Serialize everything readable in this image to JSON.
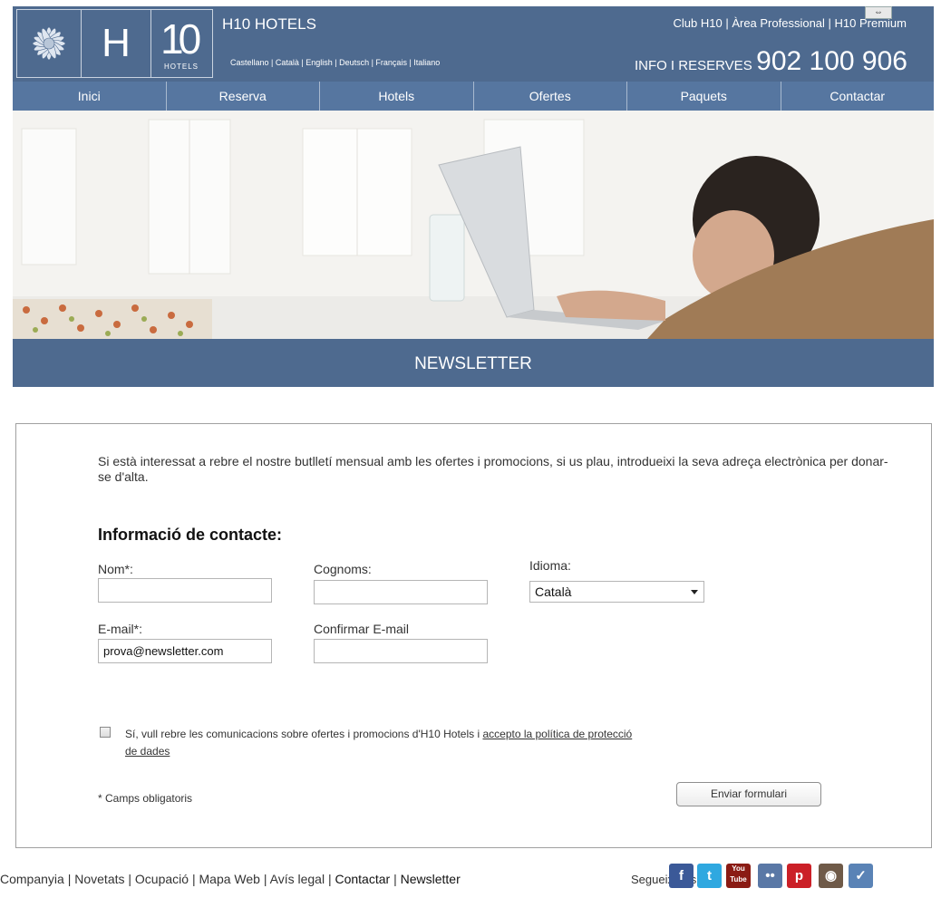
{
  "header": {
    "brand_name": "H10 HOTELS",
    "logo_letter": "H",
    "logo_number": "10",
    "logo_small": "HOTELS",
    "languages": "Castellano | Català | English | Deutsch | Français | Italiano",
    "top_links": "Club H10 | Àrea Professional | H10 Premium",
    "phone_prefix": "INFO I RESERVES",
    "phone_number": "902 100 906"
  },
  "nav": {
    "items": [
      "Inici",
      "Reserva",
      "Hotels",
      "Ofertes",
      "Paquets",
      "Contactar"
    ]
  },
  "section_title": "NEWSLETTER",
  "form": {
    "intro": "Si està interessat a rebre el nostre butlletí mensual amb les ofertes i promocions, si us plau, introdueixi la seva adreça electrònica per donar-se d'alta.",
    "heading": "Informació de contacte:",
    "name_label": "Nom*:",
    "name_value": "",
    "surname_label": "Cognoms:",
    "surname_value": "",
    "language_label": "Idioma:",
    "language_value": "Català",
    "email_label": "E-mail*:",
    "email_value": "prova@newsletter.com",
    "confirm_email_label": "Confirmar E-mail",
    "confirm_email_value": "",
    "consent_text": "Sí, vull rebre les comunicacions sobre ofertes i promocions d'H10 Hotels i ",
    "consent_link": "accepto la política de protecció de dades",
    "consent_checked": false,
    "required_note": "* Camps obligatoris",
    "submit_label": "Enviar formulari"
  },
  "footer": {
    "links": [
      "Companyia",
      "Novetats",
      "Ocupació",
      "Mapa Web",
      "Avís legal",
      "Contactar",
      "Newsletter"
    ],
    "follow_label": "Segueix-nos a:",
    "social": [
      {
        "name": "facebook-icon",
        "glyph": "f",
        "color": "#3b5998"
      },
      {
        "name": "twitter-icon",
        "glyph": "t",
        "color": "#2fa8e0"
      },
      {
        "name": "youtube-icon",
        "glyph": "You Tube",
        "color": "#8a1b14"
      },
      {
        "name": "flickr-icon",
        "glyph": "••",
        "color": "#5a78a6"
      },
      {
        "name": "pinterest-icon",
        "glyph": "p",
        "color": "#cb2027"
      },
      {
        "name": "instagram-icon",
        "glyph": "◉",
        "color": "#6f5a48"
      },
      {
        "name": "tripadvisor-icon",
        "glyph": "✓",
        "color": "#5a83b6"
      }
    ]
  }
}
